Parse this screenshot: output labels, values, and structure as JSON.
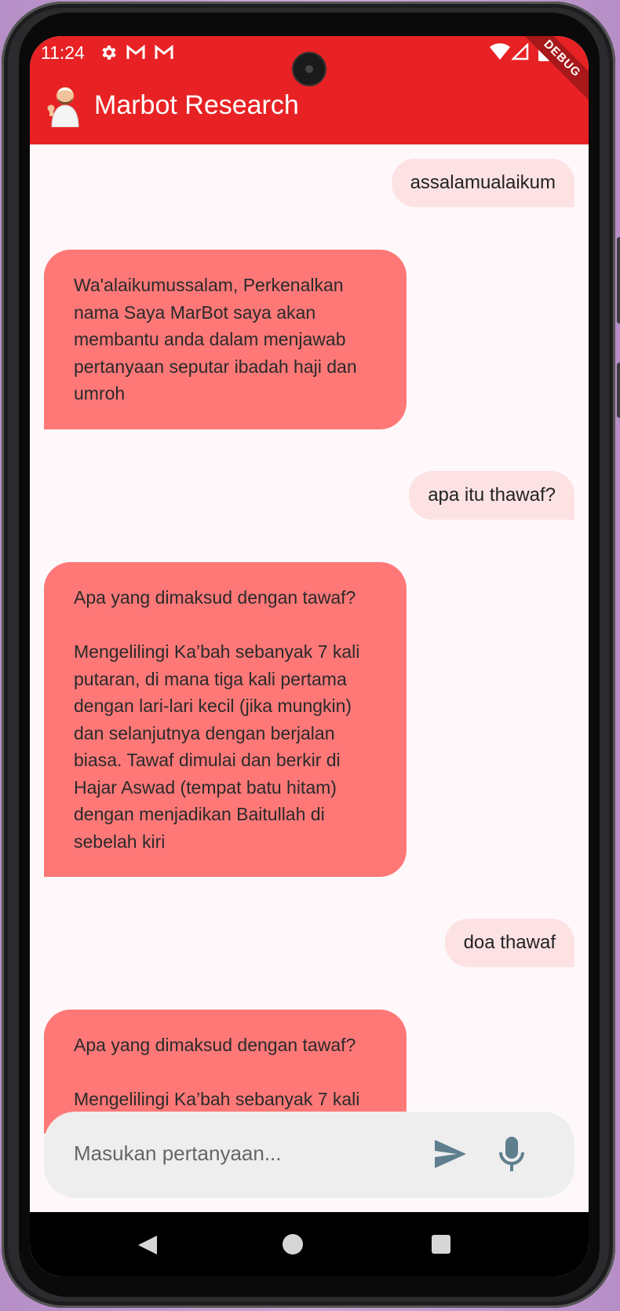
{
  "status_bar": {
    "time": "11:24",
    "debug_banner": "DEBUG"
  },
  "app_bar": {
    "title": "Marbot Research"
  },
  "messages": [
    {
      "role": "user",
      "text": "assalamualaikum"
    },
    {
      "role": "bot",
      "text": "Wa'alaikumussalam, Perkenalkan nama Saya MarBot saya akan membantu anda dalam menjawab pertanyaan seputar ibadah haji dan umroh"
    },
    {
      "role": "user",
      "text": "apa itu thawaf?"
    },
    {
      "role": "bot",
      "text": "Apa yang dimaksud dengan tawaf?\n\nMengelilingi Ka’bah sebanyak 7 kali putaran, di mana tiga kali pertama dengan lari-lari kecil (jika mungkin) dan selanjutnya dengan berjalan biasa. Tawaf dimulai dan berkir di Hajar Aswad (tempat batu hitam) dengan menjadikan Baitullah di sebelah kiri"
    },
    {
      "role": "user",
      "text": "doa thawaf"
    },
    {
      "role": "bot",
      "text": "Apa yang dimaksud dengan tawaf?\n\nMengelilingi Ka’bah sebanyak 7 kali"
    }
  ],
  "input": {
    "placeholder": "Masukan pertanyaan..."
  },
  "colors": {
    "accent": "#e82224",
    "bot_bubble": "#ff7878",
    "user_bubble": "#fde2e4"
  }
}
